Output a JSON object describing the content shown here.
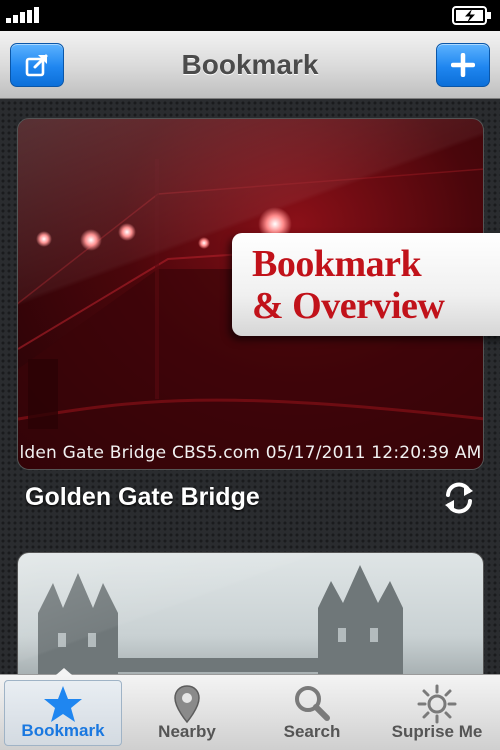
{
  "nav": {
    "title": "Bookmark",
    "left_icon": "share-icon",
    "right_icon": "plus-icon"
  },
  "cards": [
    {
      "title": "Golden Gate Bridge",
      "camera_caption": "lden Gate Bridge CBS5.com 05/17/2011 12:20:39 AM",
      "refresh_icon": "refresh-icon"
    },
    {
      "title": "",
      "camera_caption": ""
    }
  ],
  "callout": {
    "line1": "Bookmark",
    "line2": "& Overview",
    "color": "#c1121a"
  },
  "tabs": [
    {
      "label": "Bookmark",
      "icon": "star-icon",
      "active": true
    },
    {
      "label": "Nearby",
      "icon": "map-pin-icon",
      "active": false
    },
    {
      "label": "Search",
      "icon": "magnifier-icon",
      "active": false
    },
    {
      "label": "Suprise Me",
      "icon": "sun-icon",
      "active": false
    }
  ],
  "colors": {
    "accent": "#1f86f0",
    "active_tab_label": "#1a78e0"
  }
}
